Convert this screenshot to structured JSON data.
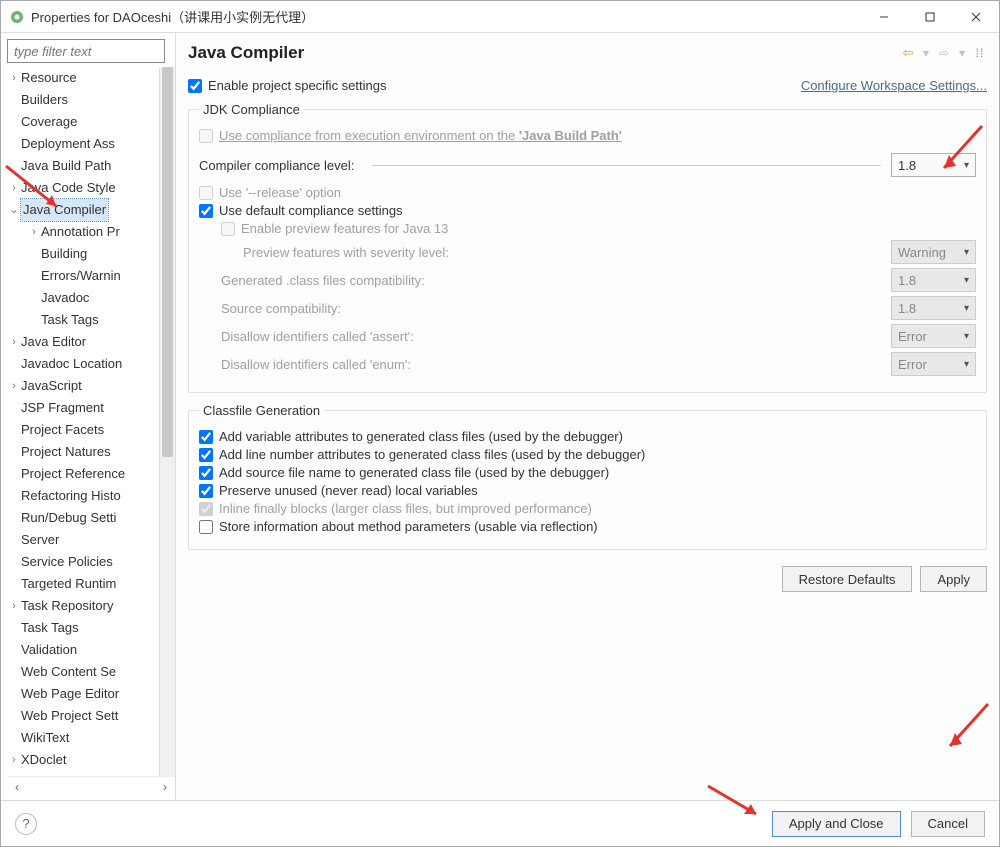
{
  "window": {
    "title": "Properties for DAOceshi（讲课用小实例无代理）"
  },
  "filter": {
    "placeholder": "type filter text"
  },
  "tree": {
    "items": [
      {
        "label": "Resource",
        "expand": ">"
      },
      {
        "label": "Builders"
      },
      {
        "label": "Coverage"
      },
      {
        "label": "Deployment Ass"
      },
      {
        "label": "Java Build Path"
      },
      {
        "label": "Java Code Style",
        "expand": ">"
      },
      {
        "label": "Java Compiler",
        "expand": "v",
        "selected": true
      },
      {
        "label": "Annotation Pr",
        "expand": ">",
        "indent": 1
      },
      {
        "label": "Building",
        "indent": 1
      },
      {
        "label": "Errors/Warnin",
        "indent": 1
      },
      {
        "label": "Javadoc",
        "indent": 1
      },
      {
        "label": "Task Tags",
        "indent": 1
      },
      {
        "label": "Java Editor",
        "expand": ">"
      },
      {
        "label": "Javadoc Location"
      },
      {
        "label": "JavaScript",
        "expand": ">"
      },
      {
        "label": "JSP Fragment"
      },
      {
        "label": "Project Facets"
      },
      {
        "label": "Project Natures"
      },
      {
        "label": "Project Reference"
      },
      {
        "label": "Refactoring Histo"
      },
      {
        "label": "Run/Debug Setti"
      },
      {
        "label": "Server"
      },
      {
        "label": "Service Policies"
      },
      {
        "label": "Targeted Runtim"
      },
      {
        "label": "Task Repository",
        "expand": ">"
      },
      {
        "label": "Task Tags"
      },
      {
        "label": "Validation"
      },
      {
        "label": "Web Content Se"
      },
      {
        "label": "Web Page Editor"
      },
      {
        "label": "Web Project Sett"
      },
      {
        "label": "WikiText"
      },
      {
        "label": "XDoclet",
        "expand": ">"
      }
    ]
  },
  "header": {
    "title": "Java Compiler"
  },
  "top": {
    "enable_label": "Enable project specific settings",
    "config_link": "Configure Workspace Settings..."
  },
  "jdk": {
    "legend": "JDK Compliance",
    "useEnv_pre": "Use compliance from execution environment on the ",
    "useEnv_link": "'Java Build Path'",
    "levelLabel": "Compiler compliance level:",
    "levelValue": "1.8",
    "release_label": "Use '--release' option",
    "default_label": "Use default compliance settings",
    "preview_label": "Enable preview features for Java 13",
    "previewLevel_label": "Preview features with severity level:",
    "previewLevel_value": "Warning",
    "genClass_label": "Generated .class files compatibility:",
    "genClass_value": "1.8",
    "source_label": "Source compatibility:",
    "source_value": "1.8",
    "assert_label": "Disallow identifiers called 'assert':",
    "assert_value": "Error",
    "enum_label": "Disallow identifiers called 'enum':",
    "enum_value": "Error"
  },
  "classfile": {
    "legend": "Classfile Generation",
    "c1": "Add variable attributes to generated class files (used by the debugger)",
    "c2": "Add line number attributes to generated class files (used by the debugger)",
    "c3": "Add source file name to generated class file (used by the debugger)",
    "c4": "Preserve unused (never read) local variables",
    "c5": "Inline finally blocks (larger class files, but improved performance)",
    "c6": "Store information about method parameters (usable via reflection)"
  },
  "buttons": {
    "restore": "Restore Defaults",
    "apply": "Apply",
    "applyClose": "Apply and Close",
    "cancel": "Cancel"
  }
}
